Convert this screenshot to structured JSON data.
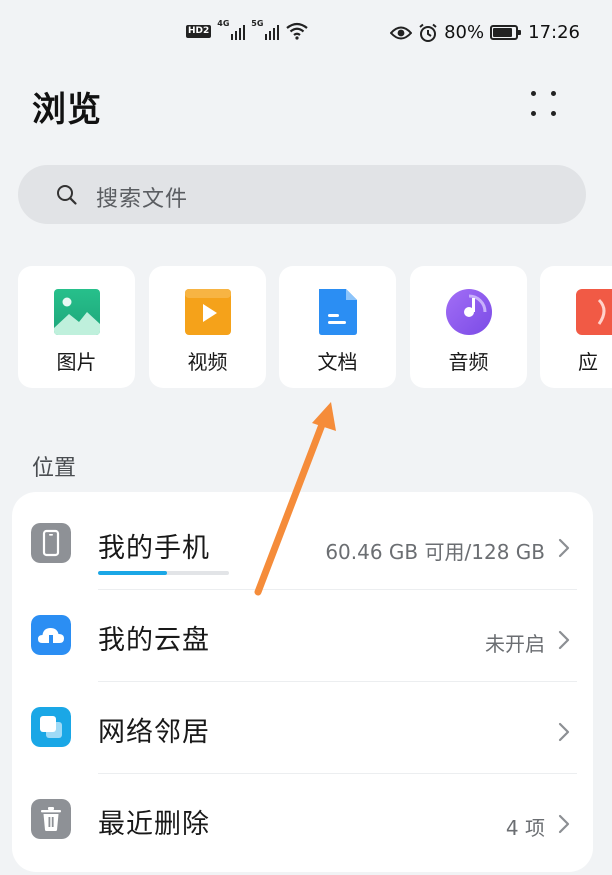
{
  "status_bar": {
    "hd_label": "HD",
    "hd_sub": "2",
    "sim1_network": "4G",
    "sim2_network": "5G",
    "battery_percent": "80%",
    "battery_level": 0.8,
    "time": "17:26",
    "icons": [
      "hd-icon",
      "signal-icon",
      "wifi-icon",
      "eye-icon",
      "alarm-icon",
      "battery-icon"
    ]
  },
  "header": {
    "title": "浏览",
    "more_icon": "more-dots-icon"
  },
  "search": {
    "placeholder": "搜索文件",
    "icon": "search-icon"
  },
  "categories": [
    {
      "label": "图片",
      "icon": "image-icon",
      "color": "#2bbd8f"
    },
    {
      "label": "视频",
      "icon": "video-icon",
      "color": "#f5a21a"
    },
    {
      "label": "文档",
      "icon": "document-icon",
      "color": "#2b8ef3"
    },
    {
      "label": "音频",
      "icon": "audio-icon",
      "color": "#8a5cf0"
    },
    {
      "label": "应",
      "icon": "app-icon",
      "color": "#f15a45"
    }
  ],
  "location": {
    "section_title": "位置",
    "items": [
      {
        "label": "我的手机",
        "value": "60.46 GB 可用/128 GB",
        "icon": "phone-icon",
        "color": "#8e9196",
        "storage_used_fraction": 0.53
      },
      {
        "label": "我的云盘",
        "value": "未开启",
        "icon": "cloud-drive-icon",
        "color": "#2b8ef3"
      },
      {
        "label": "网络邻居",
        "value": "",
        "icon": "network-neighbor-icon",
        "color": "#1aa7e6"
      },
      {
        "label": "最近删除",
        "value": "4 项",
        "icon": "trash-icon",
        "color": "#8e9196"
      }
    ]
  },
  "annotation": {
    "arrow_color": "#f58c3a"
  }
}
